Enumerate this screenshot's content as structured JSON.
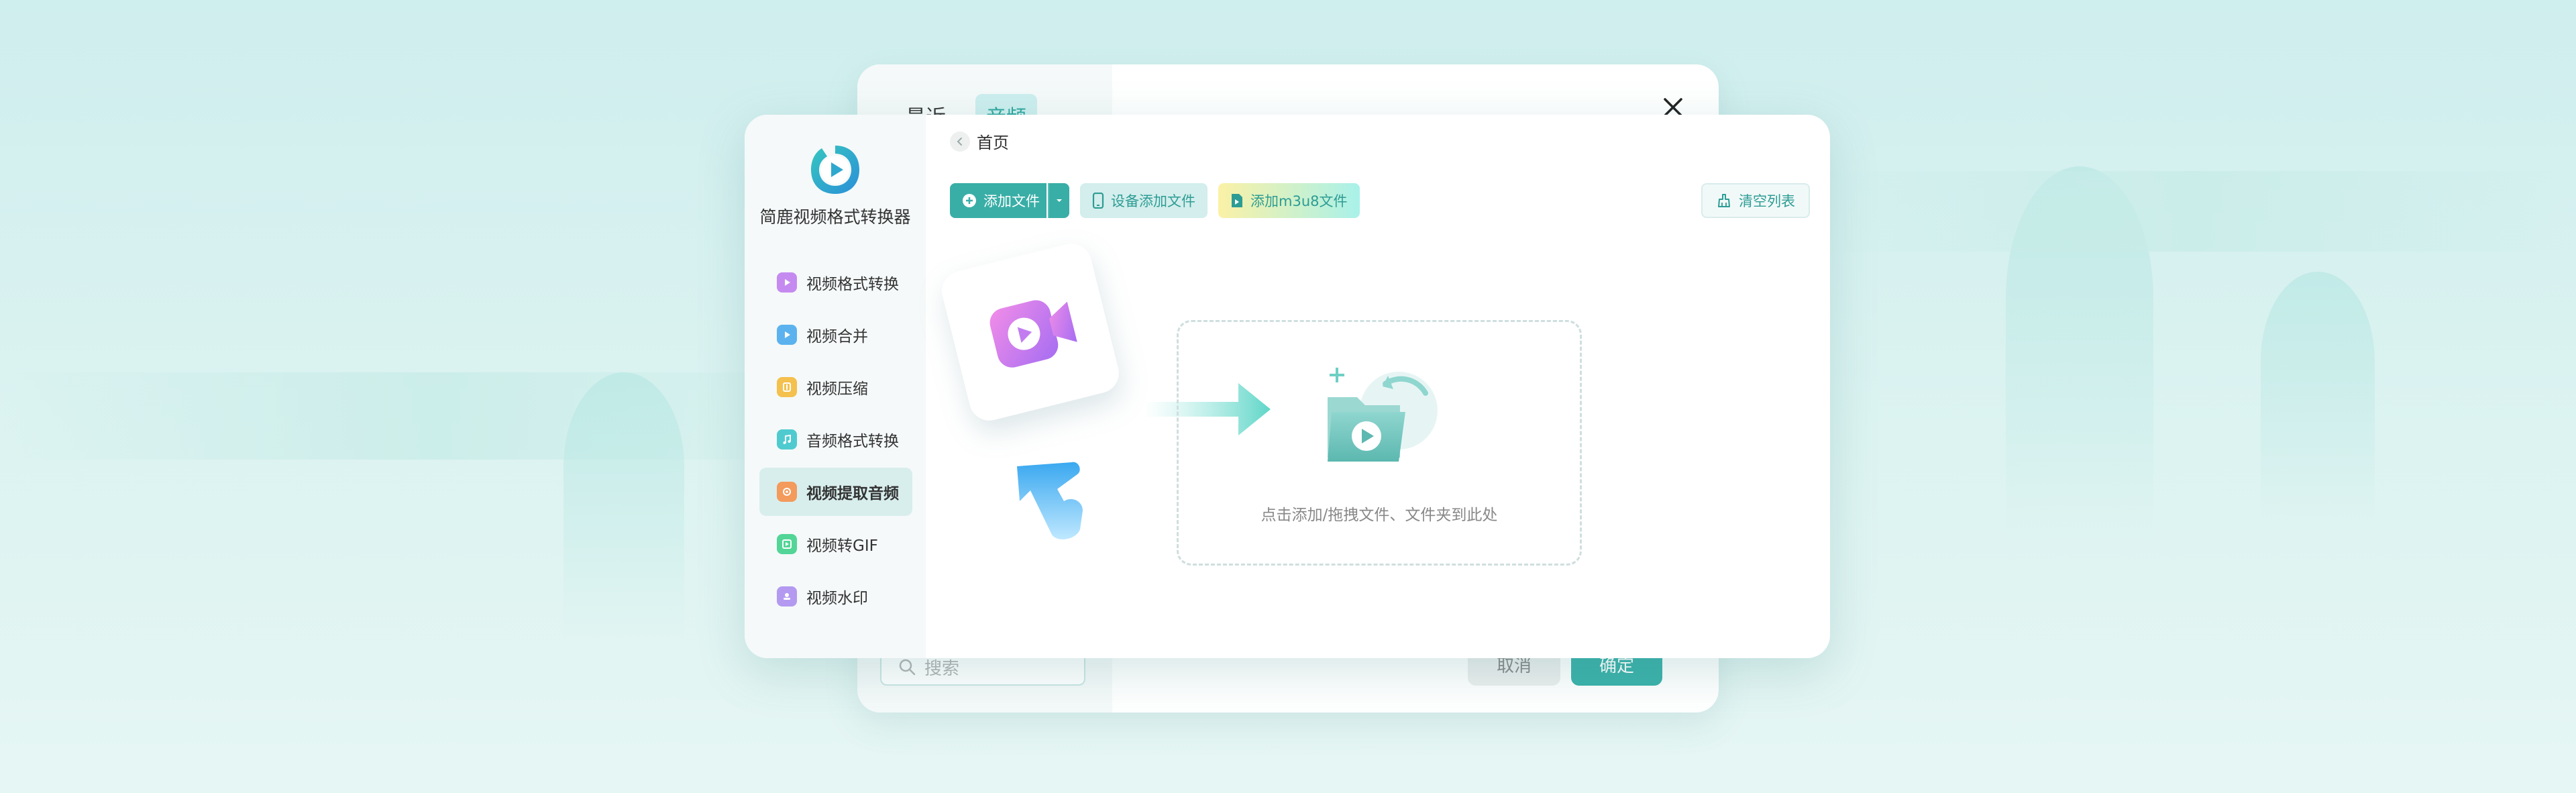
{
  "background_dialog": {
    "tabs": [
      {
        "label": "最近"
      },
      {
        "label": "音频"
      }
    ],
    "search_placeholder": "搜索",
    "cancel_label": "取消",
    "ok_label": "确定"
  },
  "app": {
    "name": "简鹿视频格式转换器",
    "accent_color": "#39aea6"
  },
  "sidebar": {
    "items": [
      {
        "label": "视频格式转换",
        "icon": "video-convert-icon",
        "color": "#b36ee8",
        "active": false
      },
      {
        "label": "视频合并",
        "icon": "video-merge-icon",
        "color": "#4aa8e8",
        "active": false
      },
      {
        "label": "视频压缩",
        "icon": "video-compress-icon",
        "color": "#f2b23a",
        "active": false
      },
      {
        "label": "音频格式转换",
        "icon": "audio-convert-icon",
        "color": "#3cc2c8",
        "active": false
      },
      {
        "label": "视频提取音频",
        "icon": "extract-audio-icon",
        "color": "#f08a4a",
        "active": true
      },
      {
        "label": "视频转GIF",
        "icon": "video-gif-icon",
        "color": "#3fcf8a",
        "active": false
      },
      {
        "label": "视频水印",
        "icon": "video-watermark-icon",
        "color": "#a98aec",
        "active": false
      }
    ]
  },
  "breadcrumb": {
    "label": "首页"
  },
  "toolbar": {
    "add_file": "添加文件",
    "device_add": "设备添加文件",
    "add_m3u8": "添加m3u8文件",
    "clear_list": "清空列表"
  },
  "dropzone": {
    "hint": "点击添加/拖拽文件、文件夹到此处"
  }
}
